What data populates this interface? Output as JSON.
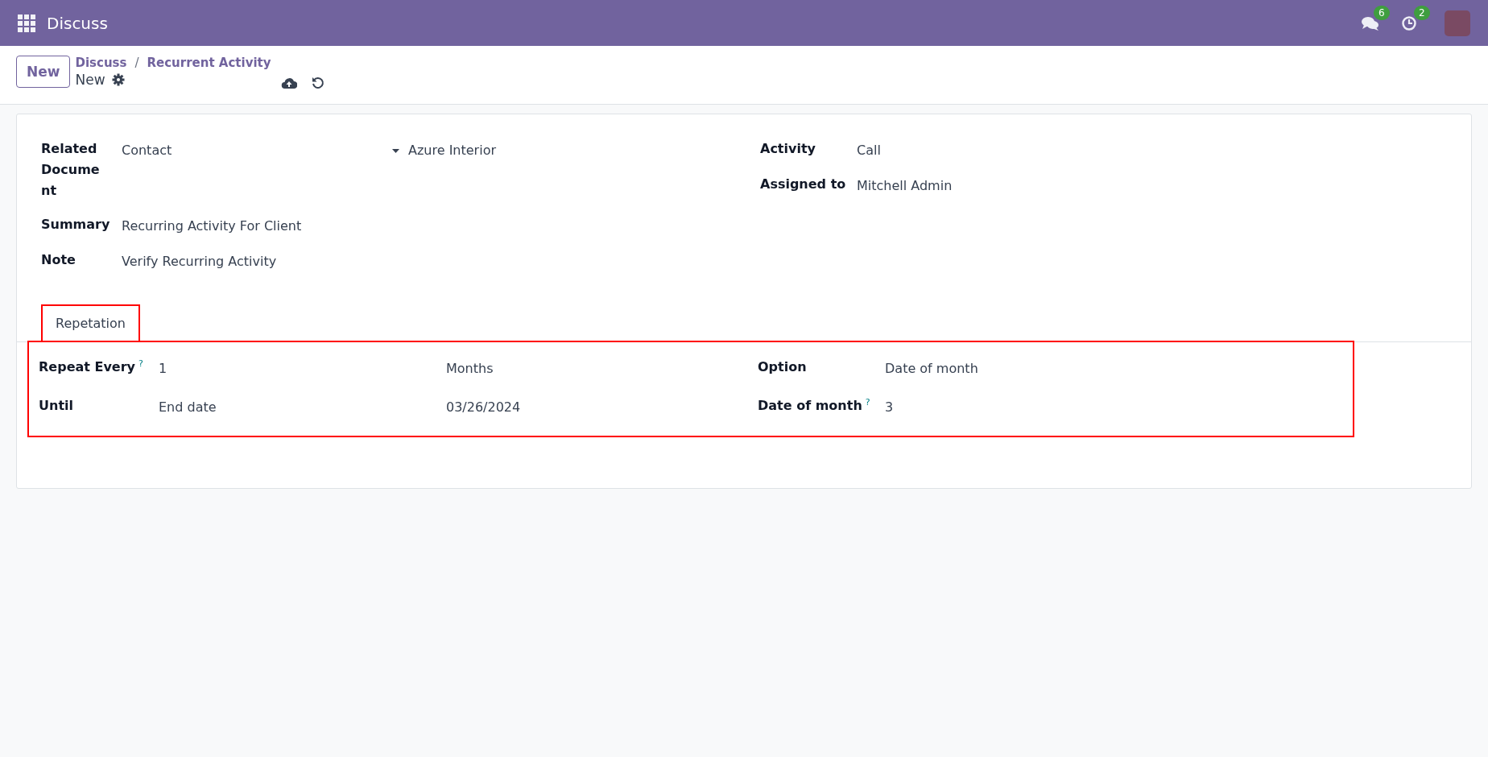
{
  "navbar": {
    "app_title": "Discuss",
    "messages_badge": "6",
    "activities_badge": "2"
  },
  "control_panel": {
    "new_button": "New",
    "breadcrumbs": [
      "Discuss",
      "Recurrent Activity"
    ],
    "breadcrumb_separator": "/",
    "record_title": "New"
  },
  "form": {
    "left_fields": [
      {
        "kind": "reference",
        "label": "Related Document",
        "model": "Contact",
        "record": "Azure Interior"
      },
      {
        "kind": "text",
        "label": "Summary",
        "value": "Recurring Activity For Client"
      },
      {
        "kind": "text",
        "label": "Note",
        "value": "Verify Recurring Activity"
      }
    ],
    "right_fields": [
      {
        "kind": "text",
        "label": "Activity",
        "value": "Call"
      },
      {
        "kind": "text",
        "label": "Assigned to",
        "value": "Mitchell Admin"
      }
    ],
    "tabs": [
      {
        "label": "Repetation",
        "selected": true,
        "highlighted": true
      }
    ],
    "repetition": {
      "highlighted": true,
      "rows": [
        {
          "label": "Repeat Every",
          "help": "?",
          "value": "1",
          "value_2": "Months",
          "right_label": "Option",
          "right_help": null,
          "right_value": "Date of month"
        },
        {
          "label": "Until",
          "help": null,
          "value": "End date",
          "value_2": "03/26/2024",
          "right_label": "Date of month",
          "right_help": "?",
          "right_value": "3"
        }
      ]
    }
  }
}
